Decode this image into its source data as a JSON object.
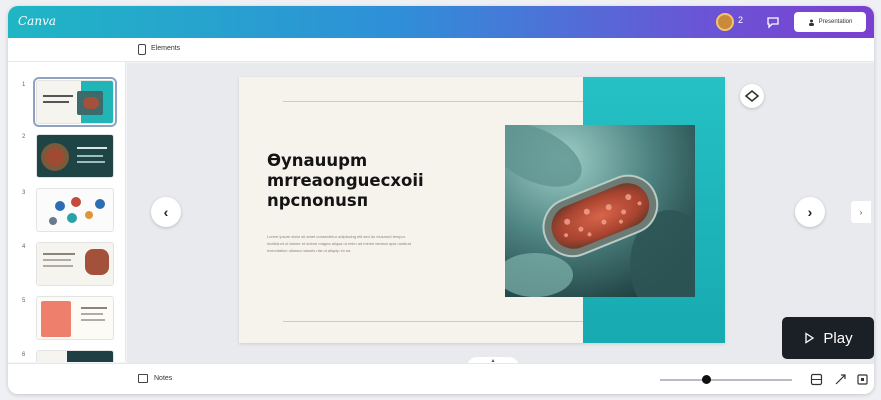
{
  "app": {
    "logo": "Canva",
    "share_label": "Presentation",
    "avatar_badge": "2"
  },
  "toolbar": {
    "title": "Elements"
  },
  "thumbnails": [
    {
      "number": "1"
    },
    {
      "number": "2"
    },
    {
      "number": "3"
    },
    {
      "number": "4"
    },
    {
      "number": "5"
    },
    {
      "number": "6"
    }
  ],
  "slide": {
    "title_lines": [
      "Өynauupm",
      "mrreaongueсхoii",
      "npсnonusп"
    ],
    "body_lines": [
      "Lorem ipsum dolor sit amet consectetur adipiscing elit sed do eiusmod tempor",
      "incididunt ut labore et dolore magna aliqua ut enim ad minim veniam quis nostrud",
      "exercitation ullamco laboris nisi ut aliquip ex ea"
    ]
  },
  "controls": {
    "prev": "‹",
    "next": "›",
    "play_label": "Play",
    "side_tab": "›"
  },
  "bottom": {
    "notes_label": "Notes",
    "zoom_fraction": 0.35
  },
  "colors": {
    "accent_teal": "#1fb6c4",
    "accent_purple": "#7b3fd0",
    "play_bg": "#1b1f26"
  }
}
